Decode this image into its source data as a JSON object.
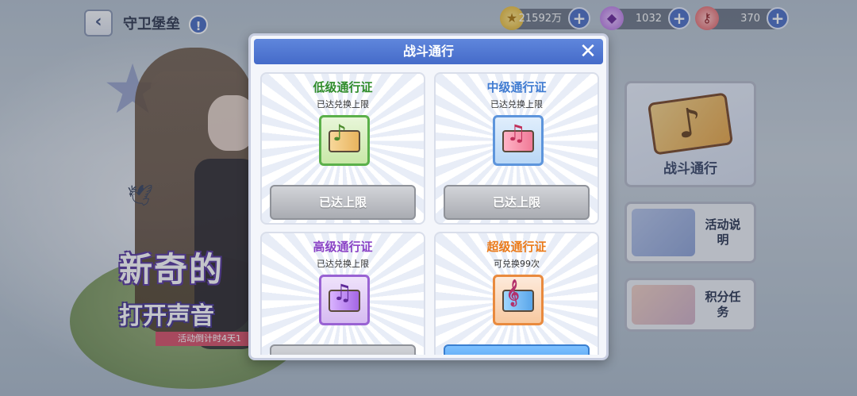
{
  "header": {
    "title": "守卫堡垒",
    "back_icon": "‹",
    "info_icon": "!"
  },
  "resources": [
    {
      "name": "gold",
      "icon": "coin-icon",
      "value": "21592万"
    },
    {
      "name": "gem",
      "icon": "gem-icon",
      "value": "1032"
    },
    {
      "name": "ticket",
      "icon": "key-icon",
      "value": "370"
    }
  ],
  "event": {
    "title": "新奇的",
    "subtitle": "打开声音",
    "countdown": "活动倒计时4天1"
  },
  "side_panels": {
    "battle_pass": "战斗通行",
    "activity_desc": "活动说明",
    "point_tasks": "积分任务"
  },
  "modal": {
    "title": "战斗通行",
    "close_icon": "✕",
    "passes": [
      {
        "name": "低级通行证",
        "status": "已达兑换上限",
        "button": "已达上限",
        "color": "#2f8c2b"
      },
      {
        "name": "中级通行证",
        "status": "已达兑换上限",
        "button": "已达上限",
        "color": "#3f7bd1"
      },
      {
        "name": "高级通行证",
        "status": "已达兑换上限",
        "button": "",
        "color": "#8a43c6"
      },
      {
        "name": "超级通行证",
        "status": "可兑换99次",
        "button": "",
        "color": "#ea7a1a"
      }
    ]
  }
}
